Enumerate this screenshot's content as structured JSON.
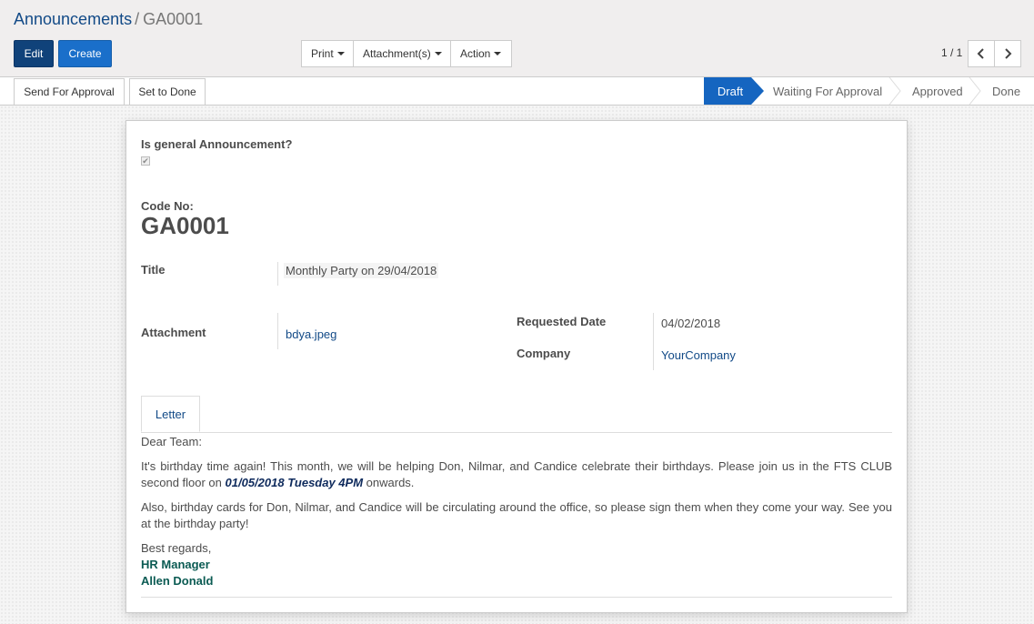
{
  "breadcrumb": {
    "parent": "Announcements",
    "separator": "/",
    "current": "GA0001"
  },
  "buttons": {
    "edit": "Edit",
    "create": "Create"
  },
  "sidebar": {
    "print": "Print",
    "attachments": "Attachment(s)",
    "action": "Action"
  },
  "pager": {
    "value": "1 / 1"
  },
  "statusbar": {
    "send_for_approval": "Send For Approval",
    "set_to_done": "Set to Done",
    "stages": [
      "Draft",
      "Waiting For Approval",
      "Approved",
      "Done"
    ],
    "active_stage": "Draft"
  },
  "form": {
    "general_label": "Is general Announcement?",
    "general_checked": true,
    "code_label": "Code No:",
    "code_value": "GA0001",
    "title_label": "Title",
    "title_value": "Monthly Party on 29/04/2018",
    "attachment_label": "Attachment",
    "attachment_value": "bdya.jpeg",
    "requested_date_label": "Requested Date",
    "requested_date_value": "04/02/2018",
    "company_label": "Company",
    "company_value": "YourCompany"
  },
  "tabs": [
    {
      "label": "Letter"
    }
  ],
  "letter": {
    "greeting": "Dear Team:",
    "p1_before": "It's birthday time again! This month, we will be helping Don, Nilmar, and Candice celebrate their birthdays. Please join us in the FTS CLUB second floor on ",
    "p1_emph": "01/05/2018 Tuesday 4PM",
    "p1_after": " onwards.",
    "p2": "Also, birthday cards for Don, Nilmar, and Candice will be circulating around the office, so please sign them when they come your way. See you at the birthday party!",
    "closing": "Best regards,",
    "sig_title": "HR Manager",
    "sig_name": "Allen Donald"
  },
  "colors": {
    "primary": "#10427a",
    "create": "#1a6fca",
    "active_stage": "#1565c0",
    "link": "#124a87",
    "signature": "#0b5b53"
  },
  "icons": {
    "prev": "chevron-left-icon",
    "next": "chevron-right-icon",
    "caret": "caret-down-icon",
    "check": "checkmark-icon"
  }
}
